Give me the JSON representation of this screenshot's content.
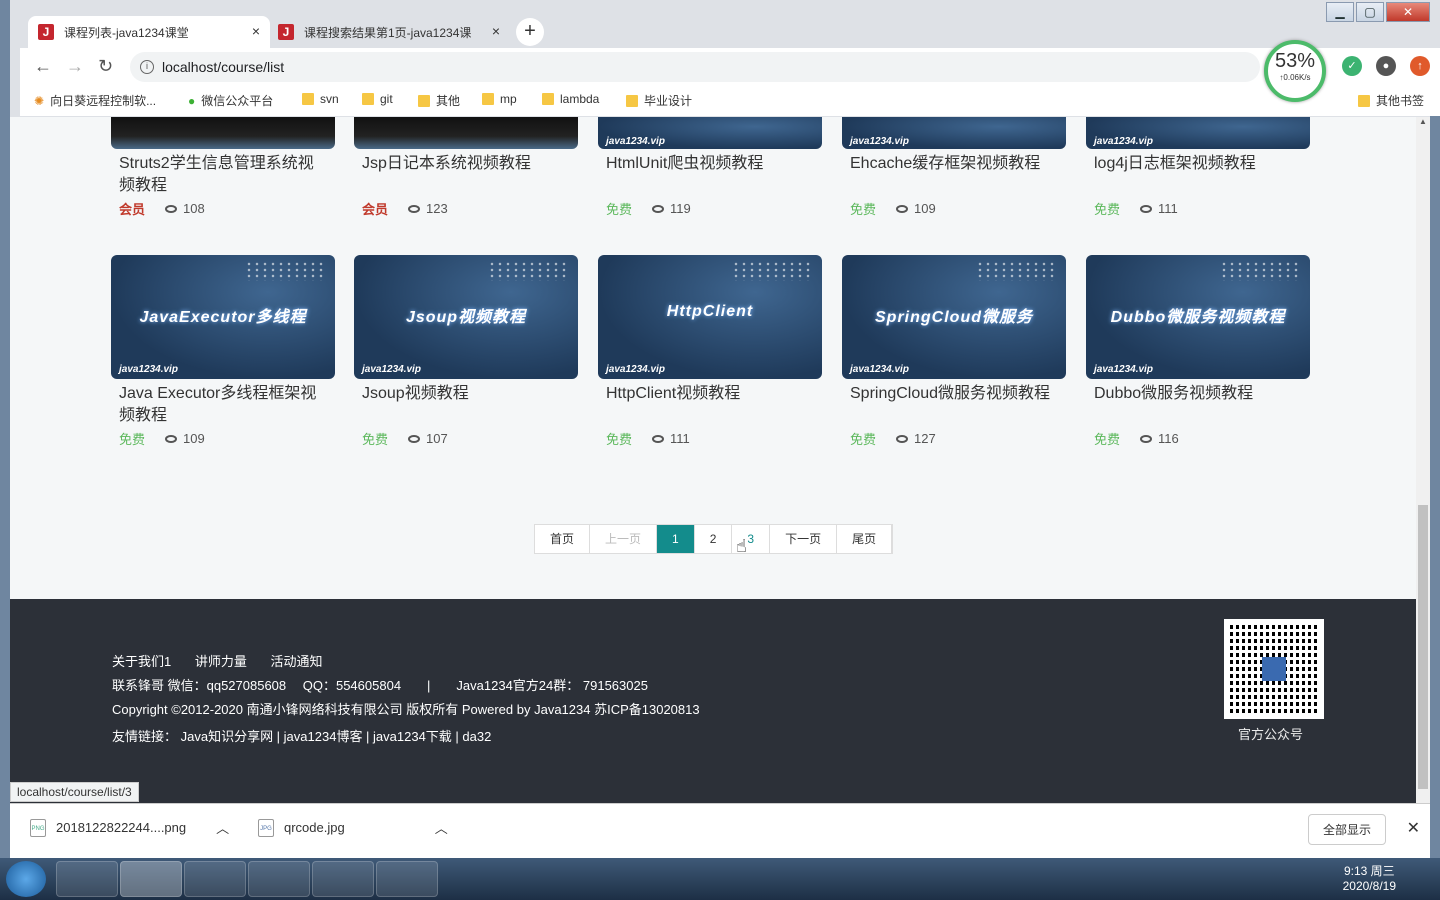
{
  "tabs": [
    {
      "title": "课程列表-java1234课堂",
      "icon": "J",
      "close": "×"
    },
    {
      "title": "课程搜索结果第1页-java1234课",
      "icon": "J",
      "close": "×"
    }
  ],
  "new_tab": "+",
  "window_buttons": {
    "min": "▁",
    "max": "▢",
    "close": "✕"
  },
  "toolbar": {
    "back": "←",
    "forward": "→",
    "reload": "↻",
    "info": "i",
    "url": "localhost/course/list"
  },
  "speed": {
    "percent": "53%",
    "rate": "↑0.06K/s"
  },
  "bookmarks": [
    {
      "label": "向日葵远程控制软..."
    },
    {
      "label": "微信公众平台"
    },
    {
      "label": "svn"
    },
    {
      "label": "git"
    },
    {
      "label": "其他"
    },
    {
      "label": "mp"
    },
    {
      "label": "lambda"
    },
    {
      "label": "毕业设计"
    }
  ],
  "other_bookmarks": "其他书签",
  "row1": [
    {
      "title": "Struts2学生信息管理系统视频教程",
      "tag": "会员",
      "views": "108",
      "type": "member"
    },
    {
      "title": "Jsp日记本系统视频教程",
      "tag": "会员",
      "views": "123",
      "type": "member"
    },
    {
      "title": "HtmlUnit爬虫视频教程",
      "tag": "免费",
      "views": "119",
      "type": "free",
      "wm": "java1234.vip"
    },
    {
      "title": "Ehcache缓存框架视频教程",
      "tag": "免费",
      "views": "109",
      "type": "free",
      "wm": "java1234.vip"
    },
    {
      "title": "log4j日志框架视频教程",
      "tag": "免费",
      "views": "111",
      "type": "free",
      "wm": "java1234.vip"
    }
  ],
  "row2": [
    {
      "thumb": "JavaExecutor多线程",
      "title": "Java Executor多线程框架视频教程",
      "tag": "免费",
      "views": "109",
      "wm": "java1234.vip"
    },
    {
      "thumb": "Jsoup视频教程",
      "title": "Jsoup视频教程",
      "tag": "免费",
      "views": "107",
      "wm": "java1234.vip"
    },
    {
      "thumb": "HttpClient",
      "title": "HttpClient视频教程",
      "tag": "免费",
      "views": "111",
      "wm": "java1234.vip"
    },
    {
      "thumb": "SpringCloud微服务",
      "title": "SpringCloud微服务视频教程",
      "tag": "免费",
      "views": "127",
      "wm": "java1234.vip"
    },
    {
      "thumb": "Dubbo微服务视频教程",
      "title": "Dubbo微服务视频教程",
      "tag": "免费",
      "views": "116",
      "wm": "java1234.vip"
    }
  ],
  "pager": {
    "first": "首页",
    "prev": "上一页",
    "p1": "1",
    "p2": "2",
    "p3": "3",
    "next": "下一页",
    "last": "尾页"
  },
  "footer": {
    "links": [
      "关于我们1",
      "讲师力量",
      "活动通知"
    ],
    "contact": "联系锋哥 微信：qq527085608　 QQ：554605804　　|　　Java1234官方24群： 791563025",
    "copyright": "Copyright ©2012-2020 南通小锋网络科技有限公司 版权所有 Powered by Java1234 苏ICP备13020813",
    "friends": "友情链接： Java知识分享网 |  java1234博客 |  java1234下载 |  da32",
    "qr_label": "官方公众号"
  },
  "status_url": "localhost/course/list/3",
  "downloads": [
    {
      "name": "2018122822244....png",
      "type": "PNG"
    },
    {
      "name": "qrcode.jpg",
      "type": "JPG"
    }
  ],
  "show_all": "全部显示",
  "dl_close": "✕",
  "tray": {
    "time": "9:13 周三",
    "date": "2020/8/19"
  }
}
